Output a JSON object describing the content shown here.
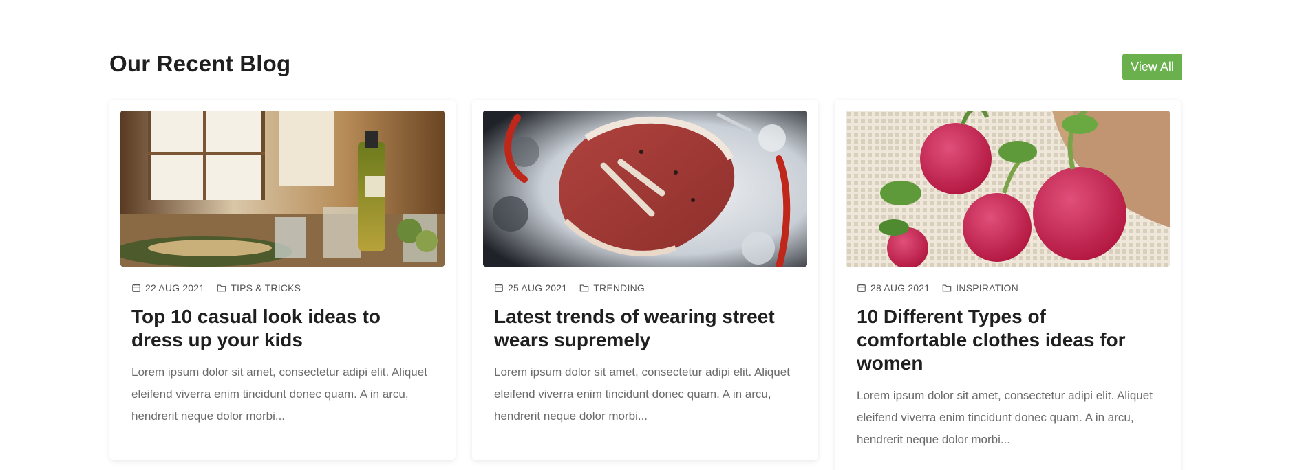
{
  "section": {
    "title": "Our Recent Blog",
    "view_all_label": "View All",
    "accent_color": "#6ab04c"
  },
  "posts": [
    {
      "date": "22 AUG 2021",
      "category": "TIPS & TRICKS",
      "title": "Top 10 casual look ideas to dress up your kids",
      "excerpt": "Lorem ipsum dolor sit amet, consectetur adipi elit. Aliquet eleifend viverra enim tincidunt donec quam. A in arcu, hendrerit neque dolor morbi...",
      "image": "dining-table-olive-oil-photo"
    },
    {
      "date": "25 AUG 2021",
      "category": "TRENDING",
      "title": "Latest trends of wearing street wears supremely",
      "excerpt": "Lorem ipsum dolor sit amet, consectetur adipi elit. Aliquet eleifend viverra enim tincidunt donec quam. A in arcu, hendrerit neque dolor morbi...",
      "image": "tbone-steak-on-ice-photo"
    },
    {
      "date": "28 AUG 2021",
      "category": "INSPIRATION",
      "title": "10 Different Types of comfortable clothes ideas for women",
      "excerpt": "Lorem ipsum dolor sit amet, consectetur adipi elit. Aliquet eleifend viverra enim tincidunt donec quam. A in arcu, hendrerit neque dolor morbi...",
      "image": "radishes-in-mesh-bag-photo"
    }
  ]
}
